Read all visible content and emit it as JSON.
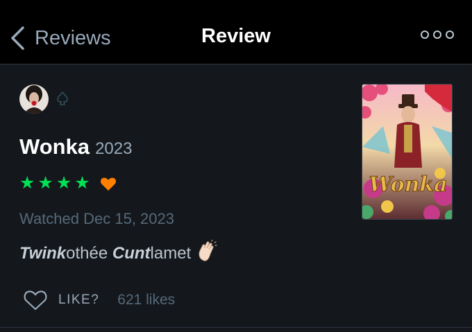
{
  "nav": {
    "back_label": "Reviews",
    "title": "Review"
  },
  "film": {
    "title": "Wonka",
    "year": "2023",
    "poster_title": "Wonka"
  },
  "review": {
    "rating_stars": 4,
    "liked": true,
    "watched": "Watched Dec 15, 2023",
    "text_parts": [
      "Twink",
      "othée ",
      "Cunt",
      "lamet"
    ]
  },
  "likes": {
    "label": "LIKE?",
    "count": "621 likes"
  },
  "colors": {
    "star": "#00e054",
    "heart": "#ff8000",
    "muted": "#56697a",
    "secondary": "#99aabb"
  },
  "icons": {
    "back": "chevron-left-icon",
    "more": "more-options-icon",
    "badge": "spade-icon",
    "clap": "clapping-hands-emoji",
    "like": "heart-outline-icon"
  }
}
